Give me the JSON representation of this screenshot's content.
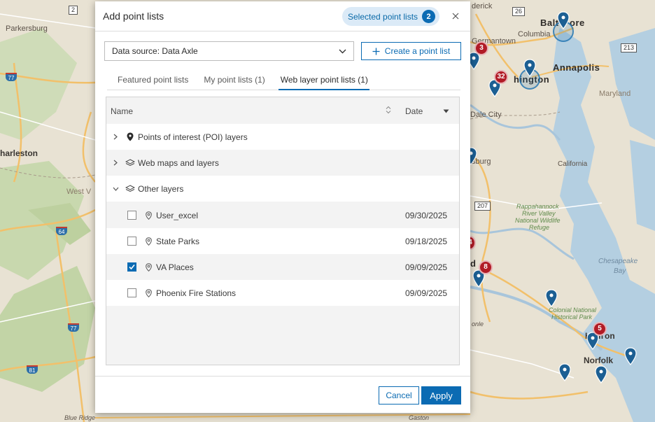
{
  "map": {
    "labels": {
      "parkersburg": "Parkersburg",
      "charleston": "harleston",
      "west_v": "West V",
      "baltimore_a": "Balt",
      "baltimore_b": "ore",
      "columbia": "Columbia",
      "germantown": "Germantown",
      "frederick": "derick",
      "annapolis": "Annapolis",
      "maryland": "Maryland",
      "washington": "hington",
      "dale_city": "Dale City",
      "burg": "sburg",
      "california": "California",
      "rappahannock": "Rappahannock",
      "river_valley": "River Valley",
      "national_wildlife": "National Wildlife",
      "refuge": "Refuge",
      "chesapeake": "Chesapeake",
      "bay": "Bay",
      "colonial_national": "Colonial National",
      "historical_park": "Historical Park",
      "hampton_a": "Ham",
      "hampton_b": "on",
      "norfolk": "Norfolk",
      "richmond": "d",
      "blue_ridge": "Blue Ridge",
      "gaston": "Gaston",
      "yonle": "onle"
    },
    "shields": {
      "s2": "2",
      "s26": "26",
      "s213": "213",
      "s207": "207",
      "i77a": "77",
      "i64": "64",
      "i77b": "77",
      "i81": "81"
    },
    "clusters": {
      "c3": "3",
      "c32": "32",
      "c8": "8",
      "c5": "5",
      "c4": "4"
    }
  },
  "dialog": {
    "title": "Add point lists",
    "selected_label": "Selected point lists",
    "selected_count": "2",
    "data_source": "Data source: Data Axle",
    "create_label": "Create a point list",
    "tabs": [
      {
        "label": "Featured point lists"
      },
      {
        "label": "My point lists (1)"
      },
      {
        "label": "Web layer point lists (1)"
      }
    ],
    "columns": {
      "name": "Name",
      "date": "Date"
    },
    "groups": [
      {
        "label": "Points of interest (POI) layers",
        "icon": "location-pin-icon",
        "expanded": false
      },
      {
        "label": "Web maps and layers",
        "icon": "layers-icon",
        "expanded": false
      },
      {
        "label": "Other layers",
        "icon": "layers-icon",
        "expanded": true
      }
    ],
    "items": [
      {
        "label": "User_excel",
        "date": "09/30/2025",
        "checked": false
      },
      {
        "label": "State Parks",
        "date": "09/18/2025",
        "checked": false
      },
      {
        "label": "VA Places",
        "date": "09/09/2025",
        "checked": true
      },
      {
        "label": "Phoenix Fire Stations",
        "date": "09/09/2025",
        "checked": false
      }
    ],
    "cancel_label": "Cancel",
    "apply_label": "Apply",
    "accent_color": "#0b6bb3"
  }
}
